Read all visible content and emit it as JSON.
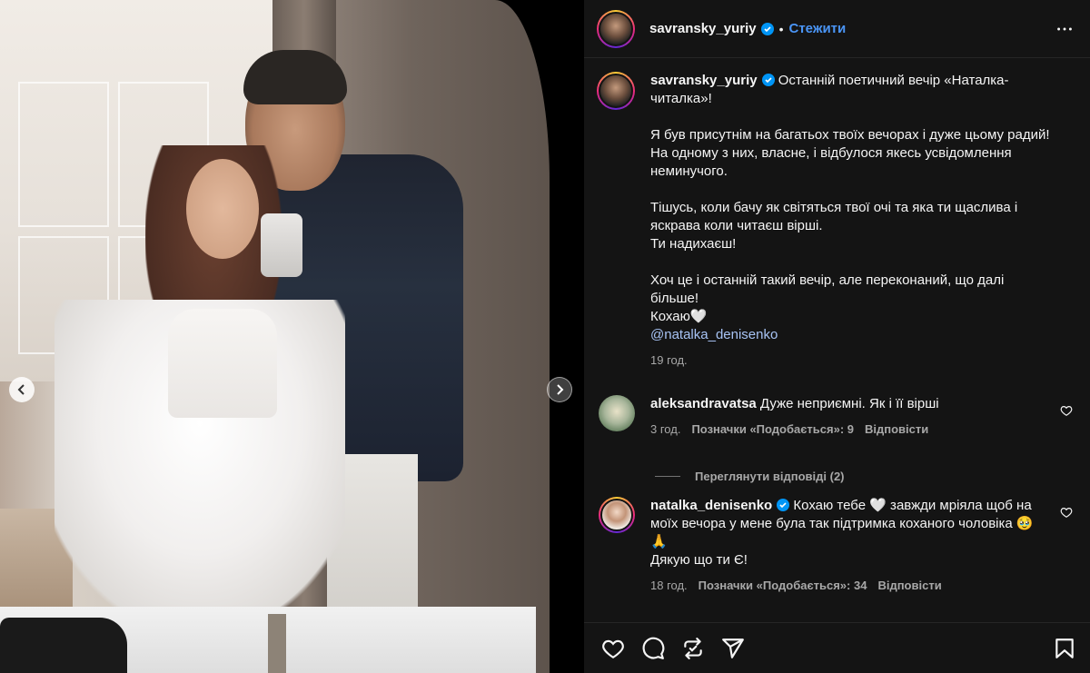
{
  "post": {
    "author": "savransky_yuriy",
    "follow_label": "Стежити",
    "separator": "•"
  },
  "caption": {
    "author": "savransky_yuriy",
    "first_line": "Останній поетичний вечір «Наталка-читалка»!",
    "paragraph2": "Я був присутнім на багатьох твоїх вечорах і дуже цьому радий! На одному з них, власне, і відбулося якесь усвідомлення неминучого.",
    "paragraph3a": "Тішусь, коли бачу як світяться твої очі та яка ти щаслива і яскрава коли читаєш вірші.",
    "paragraph3b": "Ти надихаєш!",
    "paragraph4a": "Хоч це і останній такий вечір, але переконаний, що далі більше!",
    "paragraph4b": "Кохаю🤍",
    "mention": "@natalka_denisenko",
    "time": "19 год."
  },
  "comments": [
    {
      "user": "aleksandravatsa",
      "text": "Дуже неприємні. Як і її вірші",
      "time": "3 год.",
      "likes": "Позначки «Подобається»: 9",
      "reply": "Відповісти"
    },
    {
      "user": "natalka_denisenko",
      "text": "Кохаю тебе 🤍 завжди мріяла щоб на моїх вечора у мене була так підтримка коханого чоловіка 🥹🙏",
      "text2": "Дякую що ти Є!",
      "time": "18 год.",
      "likes": "Позначки «Подобається»: 34",
      "reply": "Відповісти"
    }
  ],
  "view_replies": "Переглянути відповіді (2)",
  "colors": {
    "panel_bg": "#141414",
    "text": "#f5f5f5",
    "secondary": "#a8a8a8",
    "link": "#4a95f6",
    "mention": "#a7c3f4"
  },
  "icons": [
    "verified-badge-icon",
    "more-icon",
    "heart-icon",
    "comment-icon",
    "repost-icon",
    "share-icon",
    "bookmark-icon",
    "chevron-left-icon",
    "chevron-right-icon"
  ]
}
